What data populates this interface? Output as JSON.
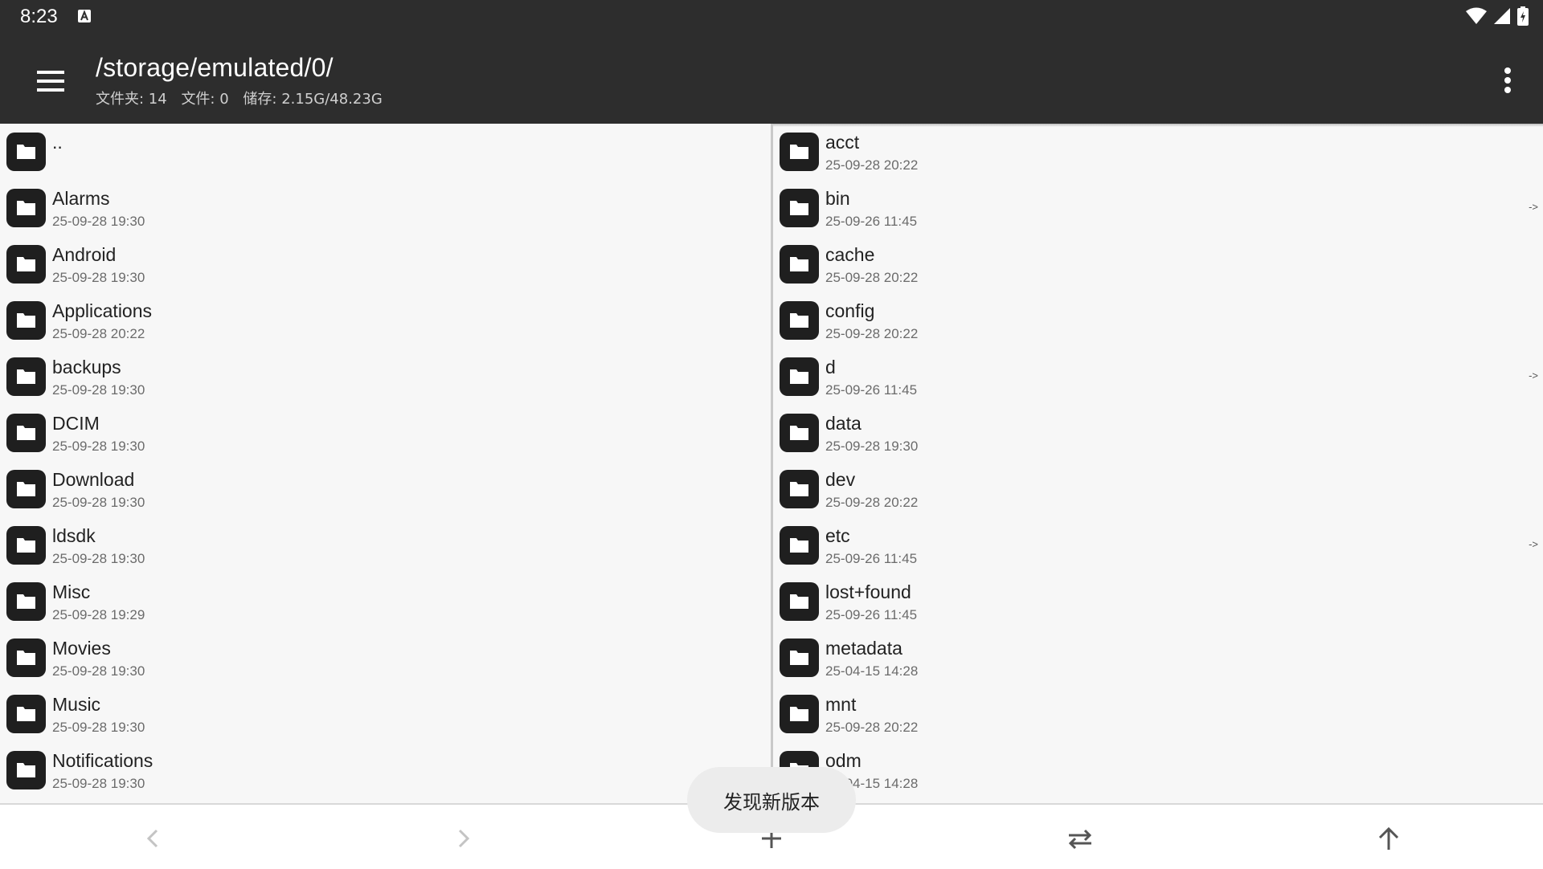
{
  "status_bar": {
    "time": "8:23",
    "icons": [
      "a-notification-icon",
      "wifi-icon",
      "cell-signal-icon",
      "battery-charging-icon"
    ]
  },
  "app_bar": {
    "title": "/storage/emulated/0/",
    "folders_stat": "文件夹: 14",
    "files_stat": "文件: 0",
    "storage_stat": "储存: 2.15G/48.23G"
  },
  "left_pane": {
    "items": [
      {
        "name": "..",
        "date": ""
      },
      {
        "name": "Alarms",
        "date": "25-09-28 19:30"
      },
      {
        "name": "Android",
        "date": "25-09-28 19:30"
      },
      {
        "name": "Applications",
        "date": "25-09-28 20:22"
      },
      {
        "name": "backups",
        "date": "25-09-28 19:30"
      },
      {
        "name": "DCIM",
        "date": "25-09-28 19:30"
      },
      {
        "name": "Download",
        "date": "25-09-28 19:30"
      },
      {
        "name": "ldsdk",
        "date": "25-09-28 19:30"
      },
      {
        "name": "Misc",
        "date": "25-09-28 19:29"
      },
      {
        "name": "Movies",
        "date": "25-09-28 19:30"
      },
      {
        "name": "Music",
        "date": "25-09-28 19:30"
      },
      {
        "name": "Notifications",
        "date": "25-09-28 19:30"
      }
    ]
  },
  "right_pane": {
    "items": [
      {
        "name": "acct",
        "date": "25-09-28 20:22",
        "link": ""
      },
      {
        "name": "bin",
        "date": "25-09-26 11:45",
        "link": "->"
      },
      {
        "name": "cache",
        "date": "25-09-28 20:22",
        "link": ""
      },
      {
        "name": "config",
        "date": "25-09-28 20:22",
        "link": ""
      },
      {
        "name": "d",
        "date": "25-09-26 11:45",
        "link": "->"
      },
      {
        "name": "data",
        "date": "25-09-28 19:30",
        "link": ""
      },
      {
        "name": "dev",
        "date": "25-09-28 20:22",
        "link": ""
      },
      {
        "name": "etc",
        "date": "25-09-26 11:45",
        "link": "->"
      },
      {
        "name": "lost+found",
        "date": "25-09-26 11:45",
        "link": ""
      },
      {
        "name": "metadata",
        "date": "25-04-15 14:28",
        "link": ""
      },
      {
        "name": "mnt",
        "date": "25-09-28 20:22",
        "link": ""
      },
      {
        "name": "odm",
        "date": "25-04-15 14:28",
        "link": ""
      }
    ]
  },
  "bottom_bar": {
    "buttons": [
      "back-icon",
      "forward-icon",
      "add-icon",
      "swap-panes-icon",
      "parent-folder-icon"
    ]
  },
  "toast": {
    "text": "发现新版本"
  }
}
